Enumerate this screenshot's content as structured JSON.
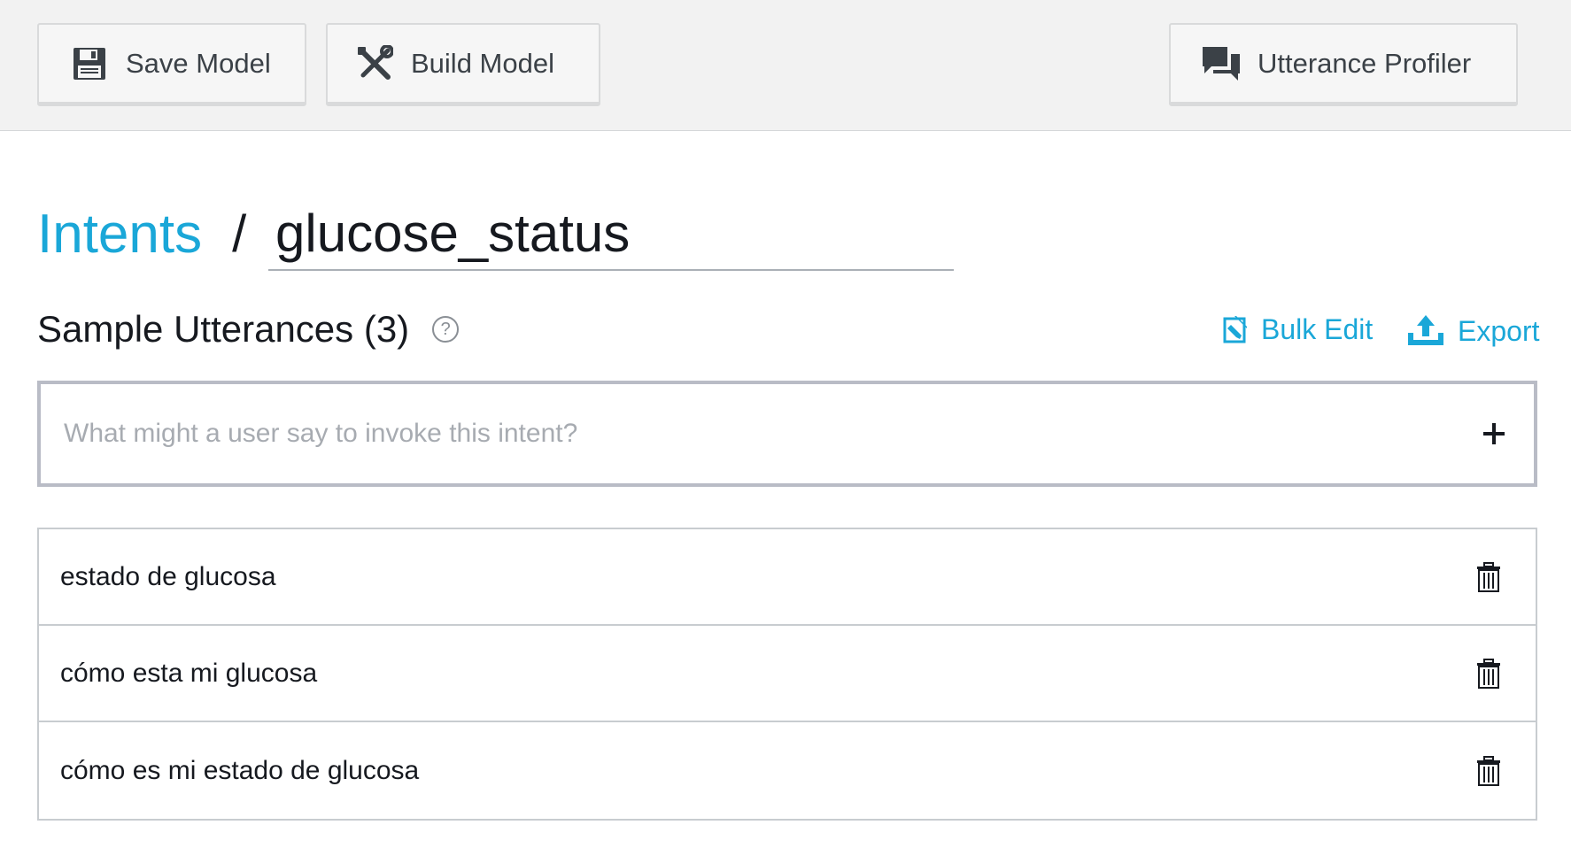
{
  "toolbar": {
    "save_label": "Save Model",
    "build_label": "Build Model",
    "profiler_label": "Utterance Profiler"
  },
  "breadcrumb": {
    "parent": "Intents",
    "separator": "/",
    "intent_name": "glucose_status"
  },
  "utterances_section": {
    "title": "Sample Utterances (3)",
    "help": "?",
    "bulk_edit_label": "Bulk Edit",
    "export_label": "Export"
  },
  "new_utterance": {
    "placeholder": "What might a user say to invoke this intent?",
    "value": "",
    "add_glyph": "+"
  },
  "utterances": [
    "estado de glucosa",
    "cómo esta mi glucosa",
    "cómo es mi estado de glucosa"
  ],
  "colors": {
    "accent": "#1aa7d8",
    "toolbar_bg": "#f2f2f2",
    "text": "#16191f"
  },
  "icons": {
    "save": "floppy-disk-icon",
    "build": "wrench-screwdriver-icon",
    "profiler": "chat-bubbles-icon",
    "bulk_edit": "bulk-edit-icon",
    "export": "upload-icon",
    "delete": "trash-icon"
  }
}
